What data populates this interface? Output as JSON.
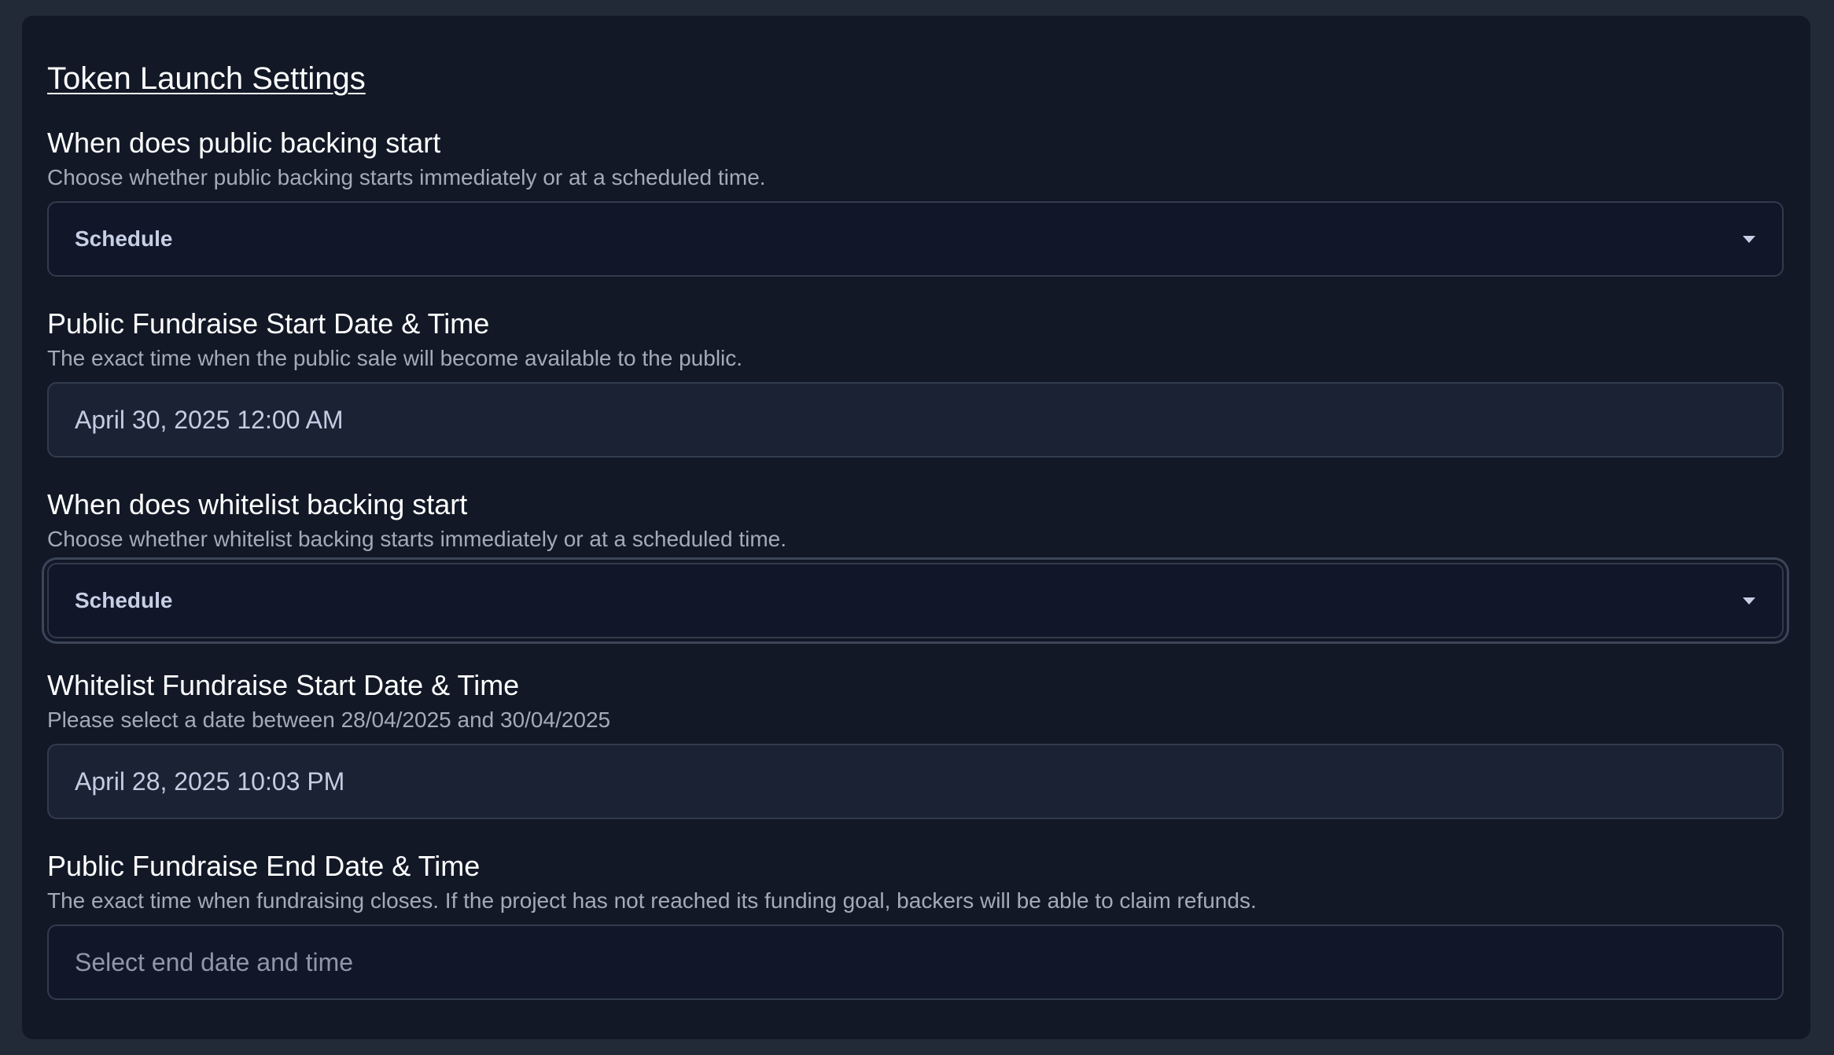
{
  "page": {
    "title": "Token Launch Settings"
  },
  "fields": {
    "public_backing_start": {
      "label": "When does public backing start",
      "help": "Choose whether public backing starts immediately or at a scheduled time.",
      "value": "Schedule"
    },
    "public_start_datetime": {
      "label": "Public Fundraise Start Date & Time",
      "help": "The exact time when the public sale will become available to the public.",
      "value": "April 30, 2025 12:00 AM"
    },
    "whitelist_backing_start": {
      "label": "When does whitelist backing start",
      "help": "Choose whether whitelist backing starts immediately or at a scheduled time.",
      "value": "Schedule"
    },
    "whitelist_start_datetime": {
      "label": "Whitelist Fundraise Start Date & Time",
      "help": "Please select a date between 28/04/2025 and 30/04/2025",
      "value": "April 28, 2025 10:03 PM"
    },
    "public_end_datetime": {
      "label": "Public Fundraise End Date & Time",
      "help": "The exact time when fundraising closes. If the project has not reached its funding goal, backers will be able to claim refunds.",
      "placeholder": "Select end date and time"
    }
  },
  "icons": {
    "dropdown": "chevron-down-icon"
  },
  "colors": {
    "page_bg": "#222a37",
    "panel_bg": "#121826",
    "border": "#323b4c",
    "text_primary": "#ffffff",
    "text_secondary": "#a4abb8",
    "control_text": "#c7cfe6"
  }
}
